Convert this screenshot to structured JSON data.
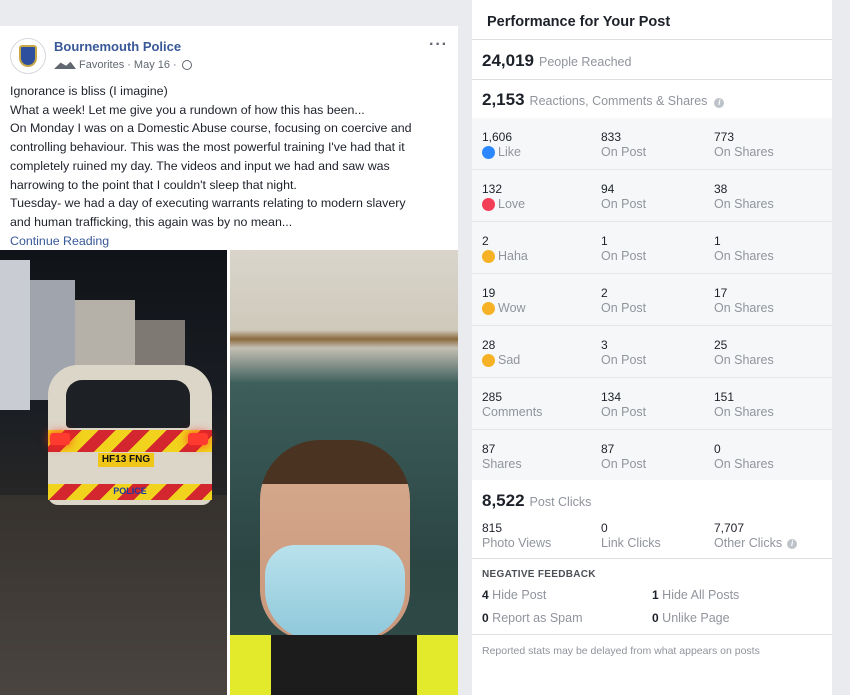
{
  "post": {
    "page_name": "Bournemouth Police",
    "favorites_label": "Favorites",
    "date": "May 16",
    "separator": "·",
    "more_icon": "more-dots-icon",
    "text_lines": [
      "Ignorance is bliss (I imagine)",
      "What a week! Let me give you a rundown of how this has been...",
      "On Monday I was on a Domestic Abuse course, focusing on coercive and",
      "controlling behaviour. This was the most powerful training I've had that it",
      "completely ruined my day. The videos and input we had and saw was",
      "harrowing to the point that I couldn't sleep that night.",
      "Tuesday- we had a day of executing warrants relating to modern slavery",
      "and human trafficking, this again was by no mean..."
    ],
    "continue_label": "Continue Reading",
    "photo_left": {
      "plate": "HF13 FNG",
      "vehicle_text": "POLICE"
    }
  },
  "panel": {
    "title": "Performance for Your Post",
    "reached": {
      "value": "24,019",
      "label": "People Reached"
    },
    "engagement": {
      "value": "2,153",
      "label": "Reactions, Comments & Shares"
    },
    "rows": [
      {
        "icon": "like-icon",
        "total": "1,606",
        "label": "Like",
        "on_post": "833",
        "on_post_label": "On Post",
        "on_shares": "773",
        "on_shares_label": "On Shares"
      },
      {
        "icon": "love-icon",
        "total": "132",
        "label": "Love",
        "on_post": "94",
        "on_post_label": "On Post",
        "on_shares": "38",
        "on_shares_label": "On Shares"
      },
      {
        "icon": "haha-icon",
        "total": "2",
        "label": "Haha",
        "on_post": "1",
        "on_post_label": "On Post",
        "on_shares": "1",
        "on_shares_label": "On Shares"
      },
      {
        "icon": "wow-icon",
        "total": "19",
        "label": "Wow",
        "on_post": "2",
        "on_post_label": "On Post",
        "on_shares": "17",
        "on_shares_label": "On Shares"
      },
      {
        "icon": "sad-icon",
        "total": "28",
        "label": "Sad",
        "on_post": "3",
        "on_post_label": "On Post",
        "on_shares": "25",
        "on_shares_label": "On Shares"
      },
      {
        "icon": "",
        "total": "285",
        "label": "Comments",
        "on_post": "134",
        "on_post_label": "On Post",
        "on_shares": "151",
        "on_shares_label": "On Shares"
      },
      {
        "icon": "",
        "total": "87",
        "label": "Shares",
        "on_post": "87",
        "on_post_label": "On Post",
        "on_shares": "0",
        "on_shares_label": "On Shares"
      }
    ],
    "post_clicks": {
      "value": "8,522",
      "label": "Post Clicks"
    },
    "clicks": [
      {
        "value": "815",
        "label": "Photo Views"
      },
      {
        "value": "0",
        "label": "Link Clicks"
      },
      {
        "value": "7,707",
        "label": "Other Clicks"
      }
    ],
    "negative_title": "NEGATIVE FEEDBACK",
    "negative": [
      {
        "value": "4",
        "label": "Hide Post"
      },
      {
        "value": "1",
        "label": "Hide All Posts"
      },
      {
        "value": "0",
        "label": "Report as Spam"
      },
      {
        "value": "0",
        "label": "Unlike Page"
      }
    ],
    "footnote": "Reported stats may be delayed from what appears on posts"
  },
  "colors": {
    "link": "#385898",
    "like": "#2d88ff",
    "love": "#f33e58",
    "emoji": "#f7b125"
  }
}
